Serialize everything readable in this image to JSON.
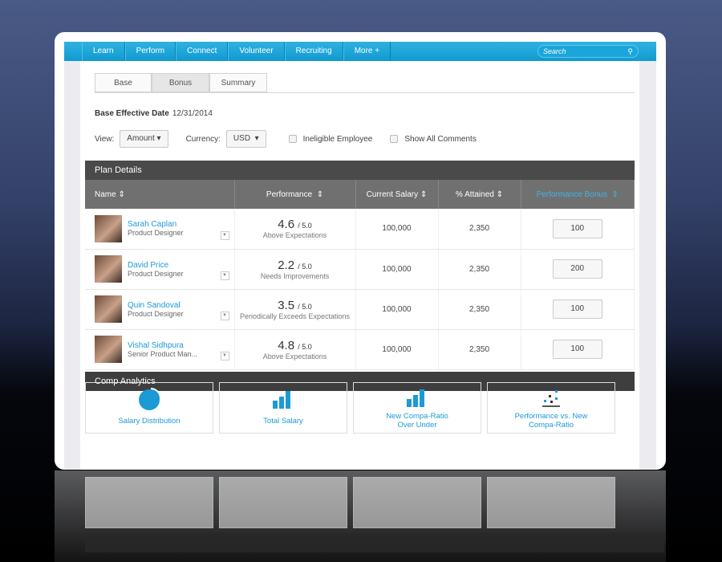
{
  "nav": {
    "items": [
      "Learn",
      "Perform",
      "Connect",
      "Volunteer",
      "Recruiting",
      "More +"
    ],
    "search_placeholder": "Search"
  },
  "tabs": [
    "Base",
    "Bonus",
    "Summary"
  ],
  "base_effective": {
    "label": "Base Effective Date",
    "value": "12/31/2014"
  },
  "filters": {
    "view_label": "View:",
    "view_value": "Amount",
    "currency_label": "Currency:",
    "currency_value": "USD",
    "ineligible": "Ineligible Employee",
    "show_comments": "Show All Comments"
  },
  "plan": {
    "title": "Plan Details",
    "columns": [
      "Name",
      "Performance",
      "Current Salary",
      "% Attained",
      "Performance Bonus"
    ],
    "rows": [
      {
        "name": "Sarah Caplan",
        "role": "Product Designer",
        "score": "4.6",
        "max": "/ 5.0",
        "rating": "Above Expectations",
        "salary": "100,000",
        "attained": "2,350",
        "bonus": "100"
      },
      {
        "name": "David Price",
        "role": "Product Designer",
        "score": "2.2",
        "max": "/ 5.0",
        "rating": "Needs Improvements",
        "salary": "100,000",
        "attained": "2,350",
        "bonus": "200"
      },
      {
        "name": "Quin Sandoval",
        "role": "Product Designer",
        "score": "3.5",
        "max": "/ 5.0",
        "rating": "Periodically Exceeds Expectations",
        "salary": "100,000",
        "attained": "2,350",
        "bonus": "100"
      },
      {
        "name": "Vishal Sidhpura",
        "role": "Senior Product Man...",
        "score": "4.8",
        "max": "/ 5.0",
        "rating": "Above Expectations",
        "salary": "100,000",
        "attained": "2,350",
        "bonus": "100"
      }
    ]
  },
  "analytics": {
    "title": "Comp Analytics",
    "tiles": [
      "Salary Distribution",
      "Total Salary",
      "New Compa-Ratio Over Under",
      "Performance vs. New Compa-Ratio"
    ]
  },
  "colors": {
    "accent": "#1c9ad6",
    "nav": "#1aa6da",
    "header": "#4a4a4a"
  }
}
